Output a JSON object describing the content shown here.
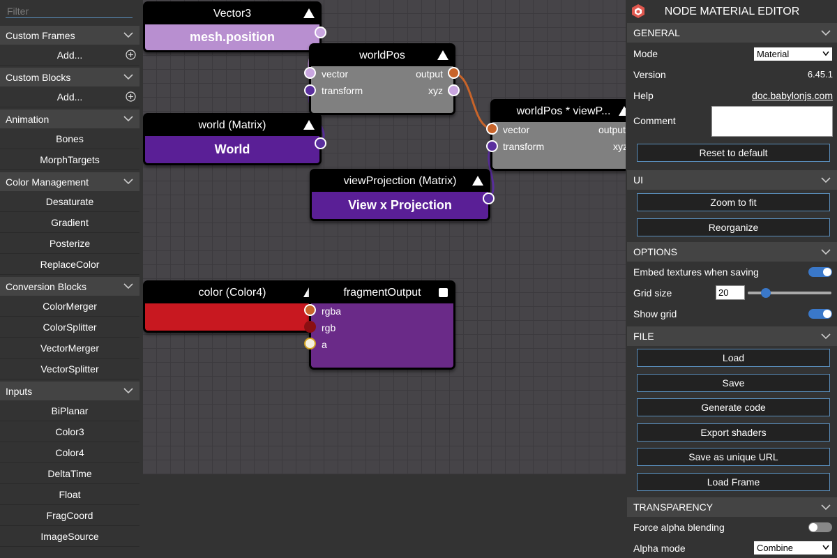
{
  "left_panel": {
    "filter_placeholder": "Filter",
    "categories": [
      {
        "label": "Custom Frames",
        "items": [
          "Add..."
        ],
        "has_add": true
      },
      {
        "label": "Custom Blocks",
        "items": [
          "Add..."
        ],
        "has_add": true
      },
      {
        "label": "Animation",
        "items": [
          "Bones",
          "MorphTargets"
        ]
      },
      {
        "label": "Color Management",
        "items": [
          "Desaturate",
          "Gradient",
          "Posterize",
          "ReplaceColor"
        ]
      },
      {
        "label": "Conversion Blocks",
        "items": [
          "ColorMerger",
          "ColorSplitter",
          "VectorMerger",
          "VectorSplitter"
        ]
      },
      {
        "label": "Inputs",
        "items": [
          "BiPlanar",
          "Color3",
          "Color4",
          "DeltaTime",
          "Float",
          "FragCoord",
          "ImageSource"
        ]
      }
    ]
  },
  "nodes": {
    "vector3": {
      "title": "Vector3",
      "value": "mesh.position"
    },
    "worldpos": {
      "title": "worldPos",
      "in1": "vector",
      "in2": "transform",
      "out1": "output",
      "out2": "xyz"
    },
    "world": {
      "title": "world (Matrix)",
      "value": "World"
    },
    "viewproj_mult": {
      "title": "worldPos * viewP...",
      "in1": "vector",
      "in2": "transform",
      "out1": "output",
      "out2": "xyz"
    },
    "viewprojection": {
      "title": "viewProjection (Matrix)",
      "value": "View x Projection"
    },
    "color4": {
      "title": "color (Color4)"
    },
    "fragment": {
      "title": "fragmentOutput",
      "in1": "rgba",
      "in2": "rgb",
      "in3": "a"
    }
  },
  "right_panel": {
    "title": "NODE MATERIAL EDITOR",
    "general": {
      "header": "GENERAL",
      "mode_label": "Mode",
      "mode_value": "Material",
      "version_label": "Version",
      "version_value": "6.45.1",
      "help_label": "Help",
      "help_value": "doc.babylonjs.com",
      "comment_label": "Comment",
      "reset_button": "Reset to default"
    },
    "ui": {
      "header": "UI",
      "zoom_button": "Zoom to fit",
      "reorganize_button": "Reorganize"
    },
    "options": {
      "header": "OPTIONS",
      "embed_label": "Embed textures when saving",
      "embed_on": true,
      "grid_label": "Grid size",
      "grid_value": "20",
      "grid_slider_fraction": 0.22,
      "showgrid_label": "Show grid",
      "showgrid_on": true
    },
    "file": {
      "header": "FILE",
      "buttons": [
        "Load",
        "Save",
        "Generate code",
        "Export shaders",
        "Save as unique URL",
        "Load Frame"
      ]
    },
    "transparency": {
      "header": "TRANSPARENCY",
      "force_alpha_label": "Force alpha blending",
      "force_alpha_on": false,
      "alpha_mode_label": "Alpha mode",
      "alpha_mode_value": "Combine"
    }
  },
  "colors": {
    "accent_blue": "#3a78c9",
    "vector3_node": "#b88fd0",
    "matrix_node": "#5a1f96",
    "color4_node": "#c81820",
    "fragment_node": "#6a2a88",
    "math_node": "#808080",
    "wire_orange": "#c8642a",
    "wire_purple": "#5a2f9e"
  }
}
